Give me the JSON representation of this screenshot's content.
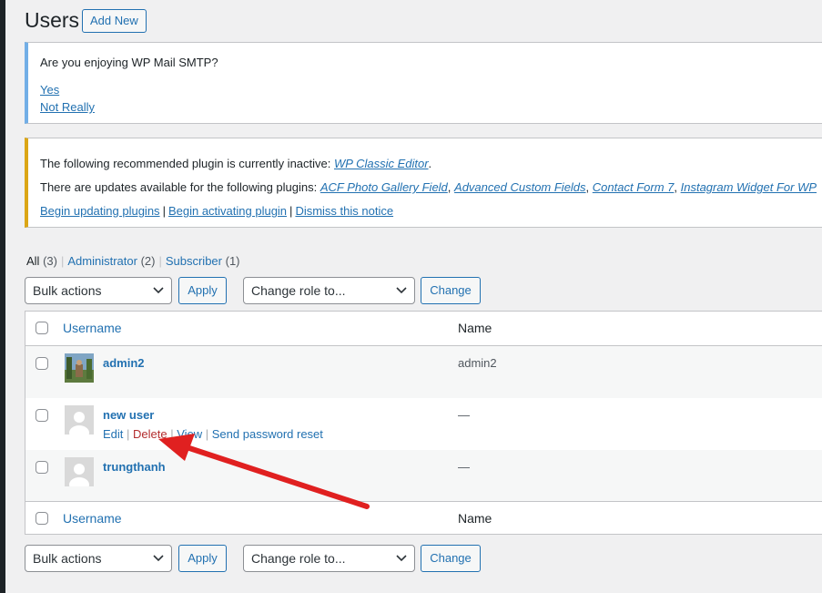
{
  "page": {
    "title": "Users",
    "add_new": "Add New"
  },
  "notice_smtp": {
    "question": "Are you enjoying WP Mail SMTP?",
    "yes": "Yes",
    "no": "Not Really"
  },
  "notice_plugins": {
    "line1_prefix": "The following recommended plugin is currently inactive: ",
    "inactive_plugin": "WP Classic Editor",
    "line1_suffix": ".",
    "line2_prefix": "There are updates available for the following plugins: ",
    "update_plugins": [
      "ACF Photo Gallery Field",
      "Advanced Custom Fields",
      "Contact Form 7",
      "Instagram Widget For WP"
    ],
    "sep": ", ",
    "actions": [
      "Begin updating plugins",
      "Begin activating plugin",
      "Dismiss this notice"
    ]
  },
  "filters": [
    {
      "label": "All",
      "count": "(3)"
    },
    {
      "label": "Administrator",
      "count": "(2)"
    },
    {
      "label": "Subscriber",
      "count": "(1)"
    }
  ],
  "bulk": {
    "bulk_actions": "Bulk actions",
    "apply": "Apply",
    "change_role": "Change role to...",
    "change": "Change"
  },
  "table": {
    "headers": {
      "username": "Username",
      "name": "Name"
    },
    "rows": [
      {
        "username": "admin2",
        "name": "admin2"
      },
      {
        "username": "new user",
        "name": "—"
      },
      {
        "username": "trungthanh",
        "name": "—"
      }
    ],
    "row_actions": {
      "edit": "Edit",
      "delete": "Delete",
      "view": "View",
      "reset": "Send password reset"
    }
  },
  "colors": {
    "link": "#2271b1",
    "delete": "#b32d2e",
    "arrow": "#e02020",
    "smtp_border": "#72aee6",
    "plugin_border": "#dba617"
  }
}
